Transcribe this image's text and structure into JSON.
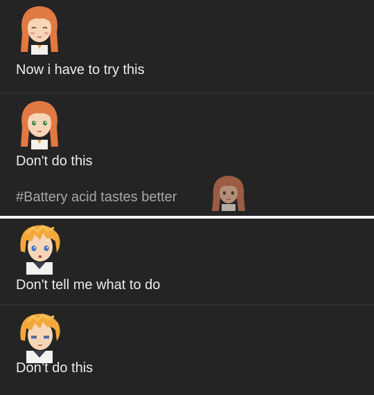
{
  "thread_top": {
    "posts": [
      {
        "avatar": "smiling-red-haired-girl-avatar",
        "text": "Now i have to try this"
      },
      {
        "avatar": "red-haired-girl-avatar",
        "text": "Don't do this",
        "tag": "#Battery acid tastes better",
        "tag_avatar": "red-haired-girl-faded-avatar"
      }
    ]
  },
  "thread_bottom": {
    "posts": [
      {
        "avatar": "blonde-boy-worried-avatar",
        "text": "Don't tell me what to do"
      },
      {
        "avatar": "blonde-boy-sleepy-avatar",
        "text": "Don’t do this"
      }
    ]
  },
  "colors": {
    "background": "#242424",
    "text": "#ececec",
    "tag_text": "#a8a8a8",
    "divider": "#383838",
    "separator": "#ffffff"
  }
}
